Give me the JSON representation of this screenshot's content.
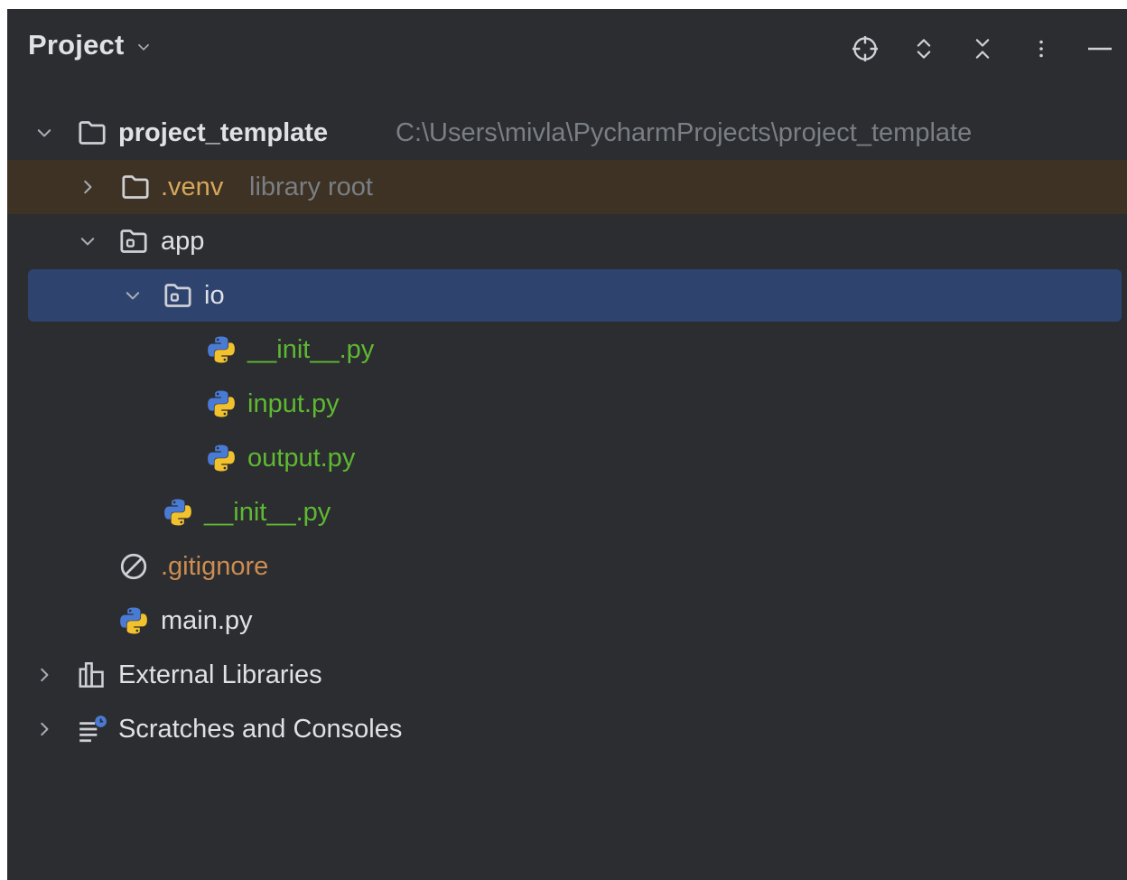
{
  "header": {
    "title": "Project",
    "tools": [
      "locate-icon",
      "expand-all-icon",
      "collapse-all-icon",
      "more-options-icon",
      "minimize-icon"
    ]
  },
  "tree": {
    "root": {
      "name": "project_template",
      "path": "C:\\Users\\mivla\\PycharmProjects\\project_template"
    },
    "venv": {
      "name": ".venv",
      "hint": "library root"
    },
    "app": {
      "name": "app"
    },
    "io": {
      "name": "io"
    },
    "io_init": {
      "name": "__init__.py"
    },
    "io_input": {
      "name": "input.py"
    },
    "io_output": {
      "name": "output.py"
    },
    "app_init": {
      "name": "__init__.py"
    },
    "gitignore": {
      "name": ".gitignore"
    },
    "main": {
      "name": "main.py"
    },
    "external_libraries": {
      "name": "External Libraries"
    },
    "scratches": {
      "name": "Scratches and Consoles"
    }
  },
  "colors": {
    "panel_bg": "#2b2d30",
    "selection": "#2e436e",
    "excluded_bg": "#3d3223",
    "text": "#dfe1e5",
    "muted": "#7a7e85",
    "python_file": "#5fb832",
    "ignored_file": "#cc8c52",
    "venv": "#d7a75c"
  }
}
